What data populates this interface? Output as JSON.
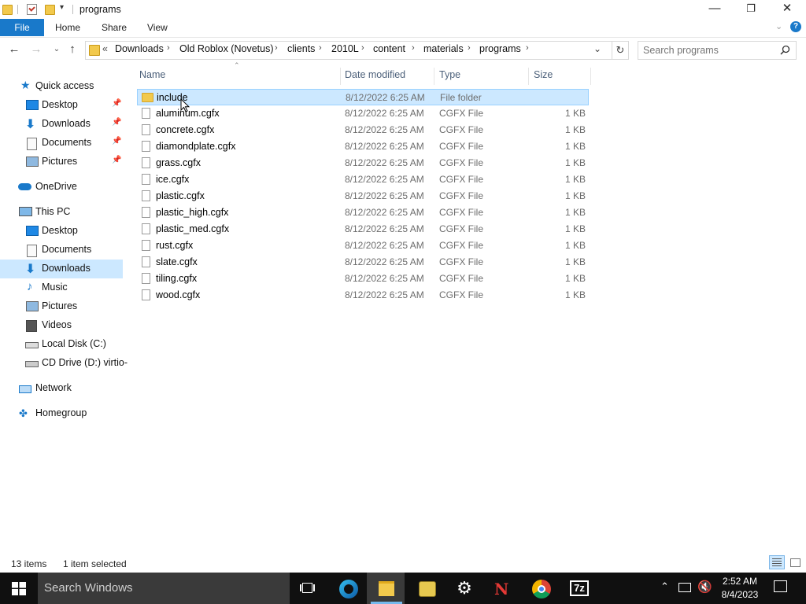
{
  "window": {
    "title": "programs"
  },
  "title_controls": {
    "minimize": "—",
    "maximize": "❐",
    "close": "✕"
  },
  "ribbon": {
    "file": "File",
    "tabs": [
      "Home",
      "Share",
      "View"
    ]
  },
  "breadcrumb": {
    "overflow": "«",
    "items": [
      "Downloads",
      "Old Roblox (Novetus)",
      "clients",
      "2010L",
      "content",
      "materials",
      "programs"
    ]
  },
  "search": {
    "placeholder": "Search programs"
  },
  "nav": {
    "quick_access": "Quick access",
    "quick_items": [
      "Desktop",
      "Downloads",
      "Documents",
      "Pictures"
    ],
    "onedrive": "OneDrive",
    "this_pc": "This PC",
    "pc_items": [
      "Desktop",
      "Documents",
      "Downloads",
      "Music",
      "Pictures",
      "Videos",
      "Local Disk (C:)",
      "CD Drive (D:) virtio-"
    ],
    "network": "Network",
    "homegroup": "Homegroup"
  },
  "columns": {
    "name": "Name",
    "date": "Date modified",
    "type": "Type",
    "size": "Size"
  },
  "files": [
    {
      "name": "include",
      "date": "8/12/2022 6:25 AM",
      "type": "File folder",
      "size": ""
    },
    {
      "name": "aluminum.cgfx",
      "date": "8/12/2022 6:25 AM",
      "type": "CGFX File",
      "size": "1 KB"
    },
    {
      "name": "concrete.cgfx",
      "date": "8/12/2022 6:25 AM",
      "type": "CGFX File",
      "size": "1 KB"
    },
    {
      "name": "diamondplate.cgfx",
      "date": "8/12/2022 6:25 AM",
      "type": "CGFX File",
      "size": "1 KB"
    },
    {
      "name": "grass.cgfx",
      "date": "8/12/2022 6:25 AM",
      "type": "CGFX File",
      "size": "1 KB"
    },
    {
      "name": "ice.cgfx",
      "date": "8/12/2022 6:25 AM",
      "type": "CGFX File",
      "size": "1 KB"
    },
    {
      "name": "plastic.cgfx",
      "date": "8/12/2022 6:25 AM",
      "type": "CGFX File",
      "size": "1 KB"
    },
    {
      "name": "plastic_high.cgfx",
      "date": "8/12/2022 6:25 AM",
      "type": "CGFX File",
      "size": "1 KB"
    },
    {
      "name": "plastic_med.cgfx",
      "date": "8/12/2022 6:25 AM",
      "type": "CGFX File",
      "size": "1 KB"
    },
    {
      "name": "rust.cgfx",
      "date": "8/12/2022 6:25 AM",
      "type": "CGFX File",
      "size": "1 KB"
    },
    {
      "name": "slate.cgfx",
      "date": "8/12/2022 6:25 AM",
      "type": "CGFX File",
      "size": "1 KB"
    },
    {
      "name": "tiling.cgfx",
      "date": "8/12/2022 6:25 AM",
      "type": "CGFX File",
      "size": "1 KB"
    },
    {
      "name": "wood.cgfx",
      "date": "8/12/2022 6:25 AM",
      "type": "CGFX File",
      "size": "1 KB"
    }
  ],
  "status": {
    "count": "13 items",
    "selected": "1 item selected"
  },
  "taskbar": {
    "search_placeholder": "Search Windows",
    "time": "2:52 AM",
    "date": "8/4/2023",
    "app_7z": "7z",
    "app_n": "N"
  },
  "colors": {
    "accent": "#1979ca",
    "selection": "#cce8ff",
    "taskbar": "#101010"
  }
}
